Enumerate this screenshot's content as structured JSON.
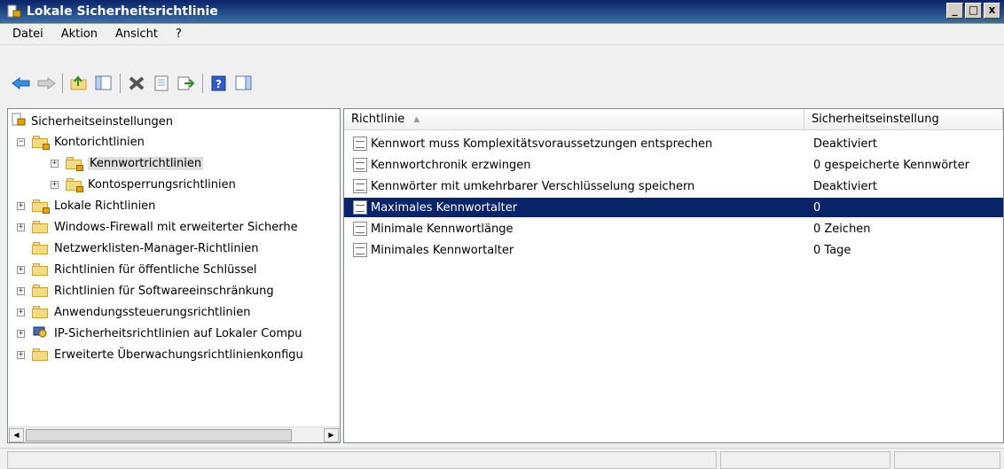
{
  "window": {
    "title": "Lokale Sicherheitsrichtlinie",
    "controls": [
      "_",
      "□",
      "x"
    ]
  },
  "menu": {
    "items": [
      "Datei",
      "Aktion",
      "Ansicht",
      "?"
    ]
  },
  "toolbar": {
    "icons": [
      "back-arrow-icon",
      "forward-arrow-icon",
      "up-folder-icon",
      "show-hide-tree-icon",
      "delete-icon",
      "properties-icon",
      "export-list-icon",
      "help-icon",
      "show-hide-action-pane-icon"
    ]
  },
  "tree": {
    "items": [
      {
        "label": "Sicherheitseinstellungen",
        "level": 0
      },
      {
        "label": "Kontorichtlinien",
        "level": 1,
        "expanded": true
      },
      {
        "label": "Kennwortrichtlinien",
        "level": 2,
        "selected": true
      },
      {
        "label": "Kontosperrungsrichtlinien",
        "level": 2
      },
      {
        "label": "Lokale Richtlinien",
        "level": 1
      },
      {
        "label": "Windows-Firewall mit erweiterter Sicherhe",
        "level": 1
      },
      {
        "label": "Netzwerklisten-Manager-Richtlinien",
        "level": 1
      },
      {
        "label": "Richtlinien für öffentliche Schlüssel",
        "level": 1
      },
      {
        "label": "Richtlinien für Softwareeinschränkung",
        "level": 1
      },
      {
        "label": "Anwendungssteuerungsrichtlinien",
        "level": 1
      },
      {
        "label": "IP-Sicherheitsrichtlinien auf Lokaler Compu",
        "level": 1
      },
      {
        "label": "Erweiterte Überwachungsrichtlinienkonfigu",
        "level": 1
      }
    ]
  },
  "list": {
    "columns": [
      "Richtlinie",
      "Sicherheitseinstellung"
    ],
    "rows": [
      {
        "policy": "Kennwort muss Komplexitätsvoraussetzungen entsprechen",
        "setting": "Deaktiviert"
      },
      {
        "policy": "Kennwortchronik erzwingen",
        "setting": "0 gespeicherte Kennwörter"
      },
      {
        "policy": "Kennwörter mit umkehrbarer Verschlüsselung speichern",
        "setting": "Deaktiviert"
      },
      {
        "policy": "Maximales Kennwortalter",
        "setting": "0",
        "selected": true
      },
      {
        "policy": "Minimale Kennwortlänge",
        "setting": "0 Zeichen"
      },
      {
        "policy": "Minimales Kennwortalter",
        "setting": "0 Tage"
      }
    ]
  },
  "colors": {
    "titlebar": "#0a246a",
    "selection": "#0a246a"
  }
}
